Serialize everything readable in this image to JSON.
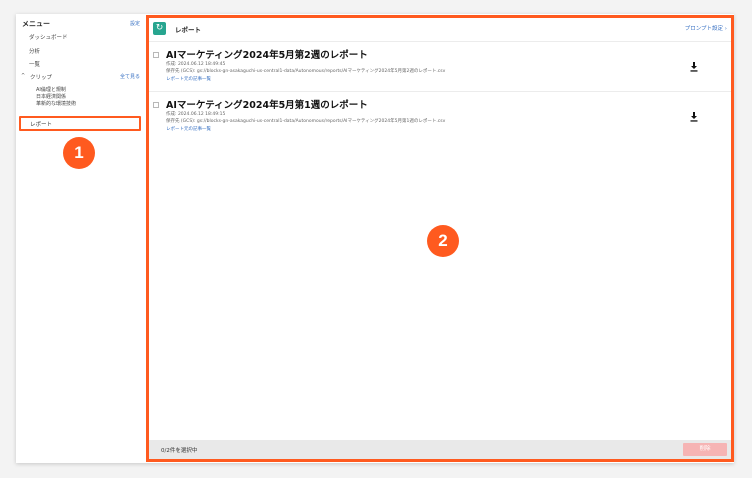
{
  "sidebar": {
    "title": "メニュー",
    "settings_label": "設定",
    "items": [
      {
        "label": "ダッシュボード"
      },
      {
        "label": "分析"
      },
      {
        "label": "一覧"
      }
    ],
    "clip": {
      "caret": "^",
      "label": "クリップ",
      "view_all": "全て見る",
      "items": [
        {
          "label": "AI倫理と規制"
        },
        {
          "label": "日本経済関係"
        },
        {
          "label": "革新的な環境技術"
        }
      ]
    },
    "report_label": "レポート"
  },
  "annotations": {
    "badge1": "1",
    "badge2": "2"
  },
  "toolbar": {
    "refresh_icon": "↻",
    "title": "レポート",
    "prompt_settings": "プロンプト設定 ›"
  },
  "reports": [
    {
      "title": "AIマーケティング2024年5月第2週のレポート",
      "created": "作成: 2024.06.12 18:49:45",
      "path": "保存先 (GCS): gs://blocks-gn-asakaguchi-us-central1-data/Autonomous/reports/AIマーケティング2024年5月第2週のレポート.csv",
      "link": "レポート元の記事一覧"
    },
    {
      "title": "AIマーケティング2024年5月第1週のレポート",
      "created": "作成: 2024.06.12 18:49:15",
      "path": "保存先 (GCS): gs://blocks-gn-asakaguchi-us-central1-data/Autonomous/reports/AIマーケティング2024年5月第1週のレポート.csv",
      "link": "レポート元の記事一覧"
    }
  ],
  "footer": {
    "status": "0/2件を選択中",
    "delete_label": "削除"
  },
  "colors": {
    "accent": "#ff5a1f",
    "link": "#3b73c4",
    "refresh": "#27a58f",
    "delete_disabled": "#f6b4b4"
  }
}
